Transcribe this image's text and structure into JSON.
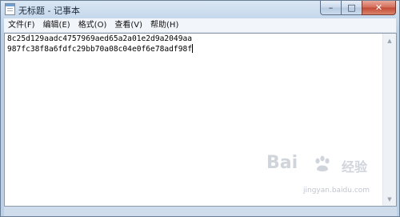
{
  "window": {
    "title": "无标题 - 记事本",
    "icon": "notepad-icon"
  },
  "caption": {
    "minimize": "–",
    "maximize": "□",
    "close": "✕"
  },
  "menu": {
    "items": [
      {
        "label": "文件(F)"
      },
      {
        "label": "编辑(E)"
      },
      {
        "label": "格式(O)"
      },
      {
        "label": "查看(V)"
      },
      {
        "label": "帮助(H)"
      }
    ]
  },
  "document": {
    "lines": [
      "8c25d129aadc4757969aed65a2a01e2d9a2049aa",
      "987fc38f8a6fdfc29bb70a08c04e0f6e78adf98f"
    ]
  },
  "watermark": {
    "logo_left": "Bai",
    "logo_right": "经验",
    "url": "jingyan.baidu.com"
  }
}
